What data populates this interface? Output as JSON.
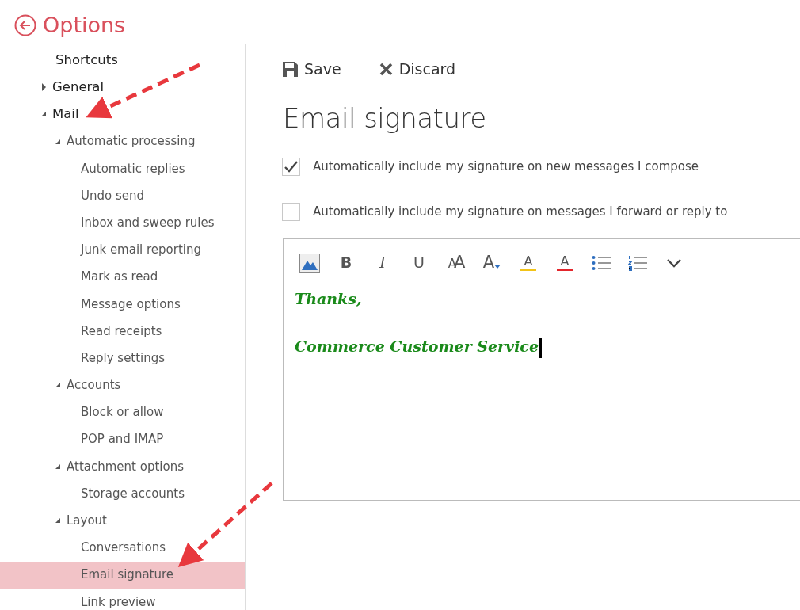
{
  "header": {
    "title": "Options"
  },
  "nav": [
    {
      "label": "Shortcuts",
      "selected": false
    },
    {
      "label": "General",
      "expanded": false,
      "selected": false
    },
    {
      "label": "Mail",
      "expanded": true,
      "selected": false,
      "children": [
        {
          "label": "Automatic processing",
          "expanded": true,
          "selected": false,
          "children": [
            {
              "label": "Automatic replies",
              "selected": false
            },
            {
              "label": "Undo send",
              "selected": false
            },
            {
              "label": "Inbox and sweep rules",
              "selected": false
            },
            {
              "label": "Junk email reporting",
              "selected": false
            },
            {
              "label": "Mark as read",
              "selected": false
            },
            {
              "label": "Message options",
              "selected": false
            },
            {
              "label": "Read receipts",
              "selected": false
            },
            {
              "label": "Reply settings",
              "selected": false
            }
          ]
        },
        {
          "label": "Accounts",
          "expanded": true,
          "selected": false,
          "children": [
            {
              "label": "Block or allow",
              "selected": false
            },
            {
              "label": "POP and IMAP",
              "selected": false
            }
          ]
        },
        {
          "label": "Attachment options",
          "expanded": true,
          "selected": false,
          "children": [
            {
              "label": "Storage accounts",
              "selected": false
            }
          ]
        },
        {
          "label": "Layout",
          "expanded": true,
          "selected": false,
          "children": [
            {
              "label": "Conversations",
              "selected": false
            },
            {
              "label": "Email signature",
              "selected": true
            },
            {
              "label": "Link preview",
              "selected": false
            }
          ]
        }
      ]
    }
  ],
  "actions": [
    {
      "kind": "save",
      "label": "Save"
    },
    {
      "kind": "discard",
      "label": "Discard"
    }
  ],
  "title": "Email signature",
  "options": [
    {
      "label": "Automatically include my signature on new messages I compose",
      "checked": true
    },
    {
      "label": "Automatically include my signature on messages I forward or reply to",
      "checked": false
    }
  ],
  "editor": {
    "toolbar": [
      {
        "kind": "picture"
      },
      {
        "kind": "bold",
        "glyph": "B"
      },
      {
        "kind": "italic",
        "glyph": "I"
      },
      {
        "kind": "underline",
        "glyph": "U"
      },
      {
        "kind": "size",
        "glyph": "AA"
      },
      {
        "kind": "grow",
        "glyph": "A"
      },
      {
        "kind": "highlight",
        "glyph": "A"
      },
      {
        "kind": "color",
        "glyph": "A"
      },
      {
        "kind": "bullets"
      },
      {
        "kind": "numbering"
      },
      {
        "kind": "more"
      }
    ],
    "lines": [
      "Thanks,",
      "Commerce Customer Service"
    ],
    "color": "#1a8a1a"
  }
}
